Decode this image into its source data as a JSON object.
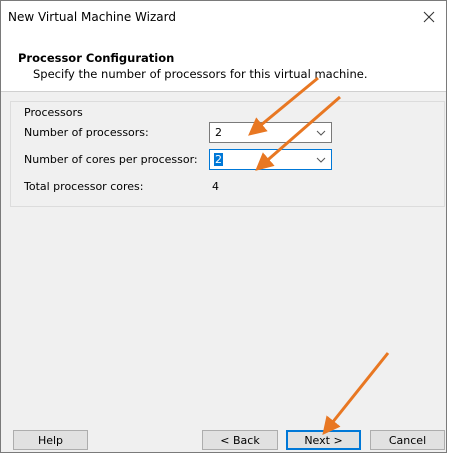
{
  "window": {
    "title": "New Virtual Machine Wizard"
  },
  "header": {
    "title": "Processor Configuration",
    "subtitle": "Specify the number of processors for this virtual machine."
  },
  "processors": {
    "group_label": "Processors",
    "num_processors_label": "Number of processors:",
    "num_processors_value": "2",
    "cores_per_processor_label": "Number of cores per processor:",
    "cores_per_processor_value": "2",
    "total_cores_label": "Total processor cores:",
    "total_cores_value": "4"
  },
  "buttons": {
    "help": "Help",
    "back": "< Back",
    "next": "Next >",
    "cancel": "Cancel"
  },
  "icons": {
    "close": "close-icon",
    "dropdown": "chevron-down-icon"
  },
  "colors": {
    "annotation_arrow": "#e87722",
    "accent": "#0078d7"
  }
}
